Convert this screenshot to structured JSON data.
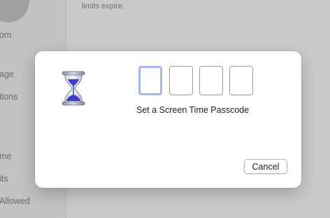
{
  "background": {
    "sidebar_items": [
      "om",
      "age",
      "tions",
      "me",
      "its",
      "Allowed"
    ],
    "content_text": "limits expire."
  },
  "dialog": {
    "icon": "hourglass-icon",
    "passcode_digits": [
      "",
      "",
      "",
      ""
    ],
    "prompt": "Set a Screen Time Passcode",
    "cancel_label": "Cancel"
  },
  "colors": {
    "focus_ring": "#a5b7f3",
    "hourglass_sand": "#3b3fc0"
  }
}
